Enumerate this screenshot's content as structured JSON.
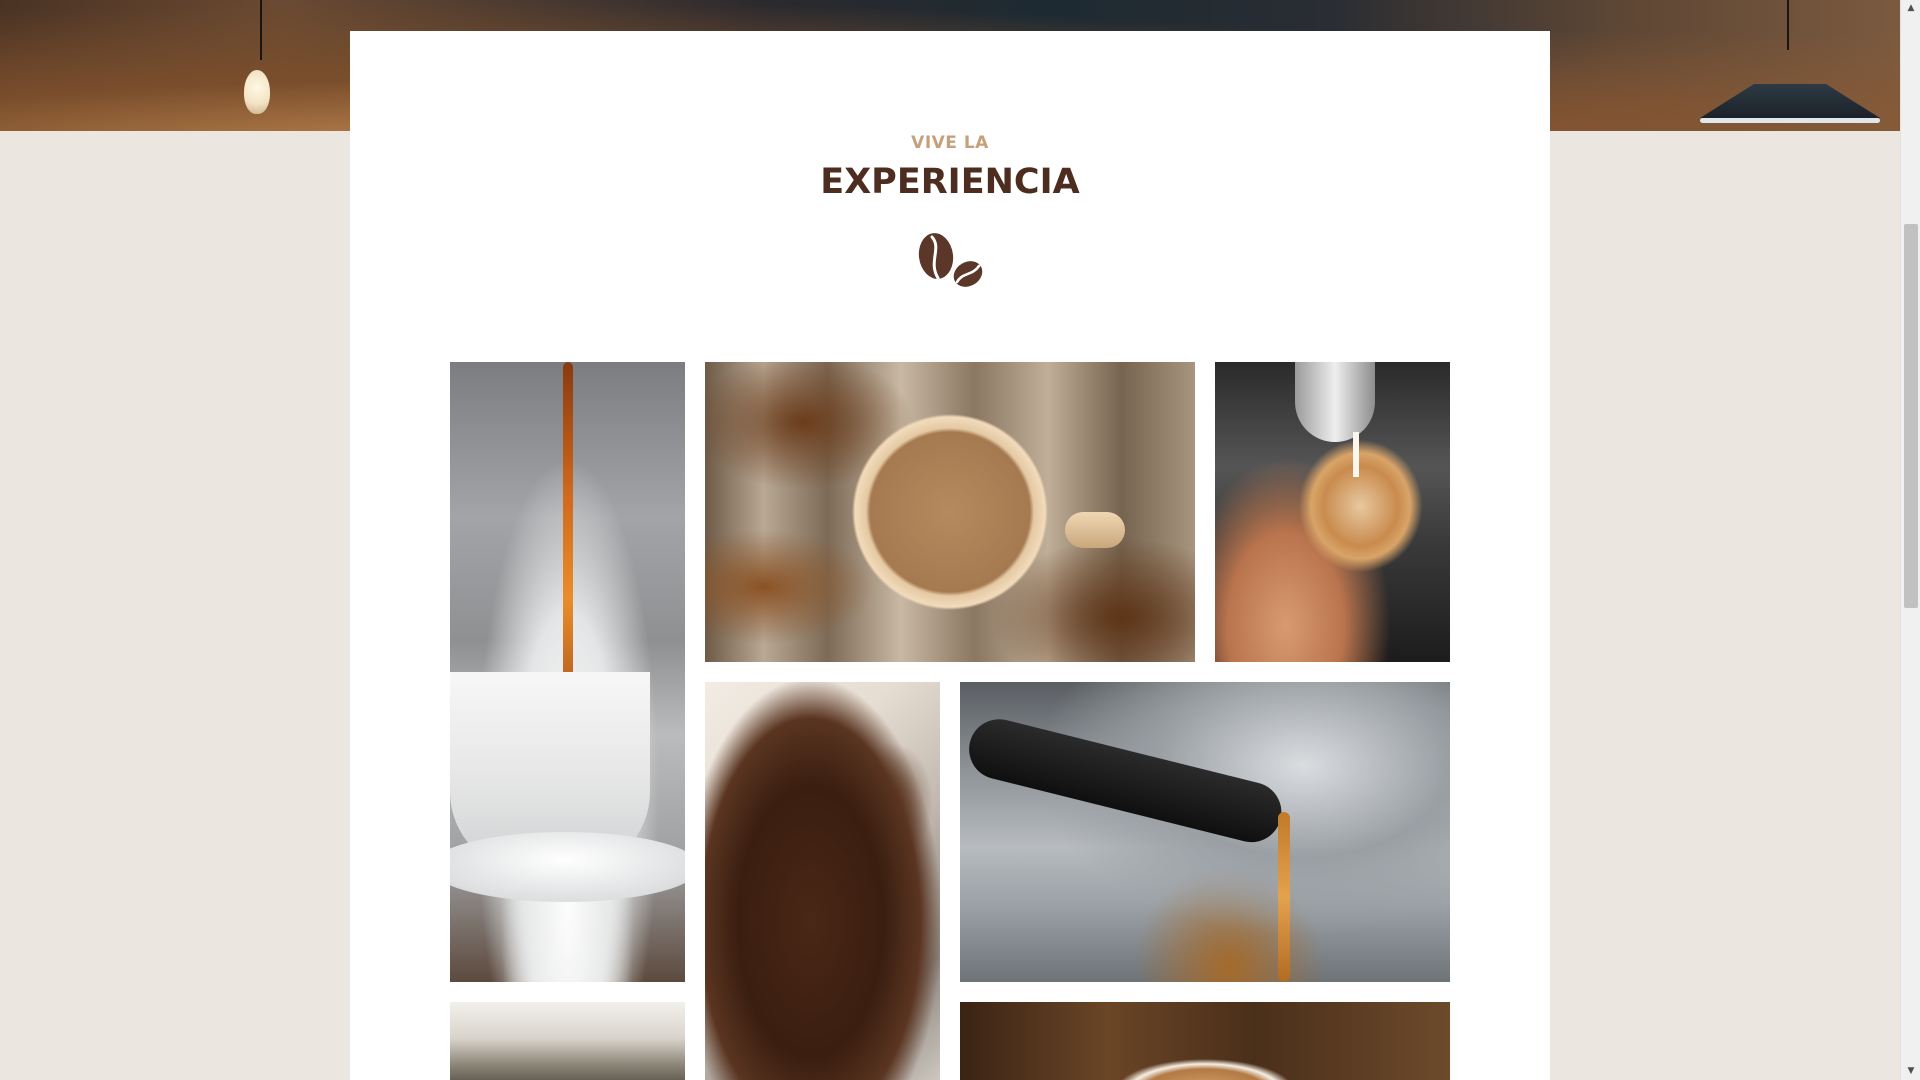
{
  "section": {
    "eyebrow": "VIVE LA",
    "title": "EXPERIENCIA",
    "icon": "coffee-beans-icon"
  },
  "colors": {
    "page_background": "#ebe6e0",
    "card_background": "#ffffff",
    "eyebrow": "#c5a07a",
    "title": "#4e2d21",
    "icon": "#5a3728"
  },
  "gallery": [
    "coffee-pouring-steam",
    "coffee-cup-on-wood",
    "latte-art-pour",
    "ground-coffee",
    "espresso-extraction",
    "cafe-interior",
    "cappuccino-top"
  ],
  "scrollbar": {
    "up_arrow": "▲",
    "down_arrow": "▼"
  }
}
